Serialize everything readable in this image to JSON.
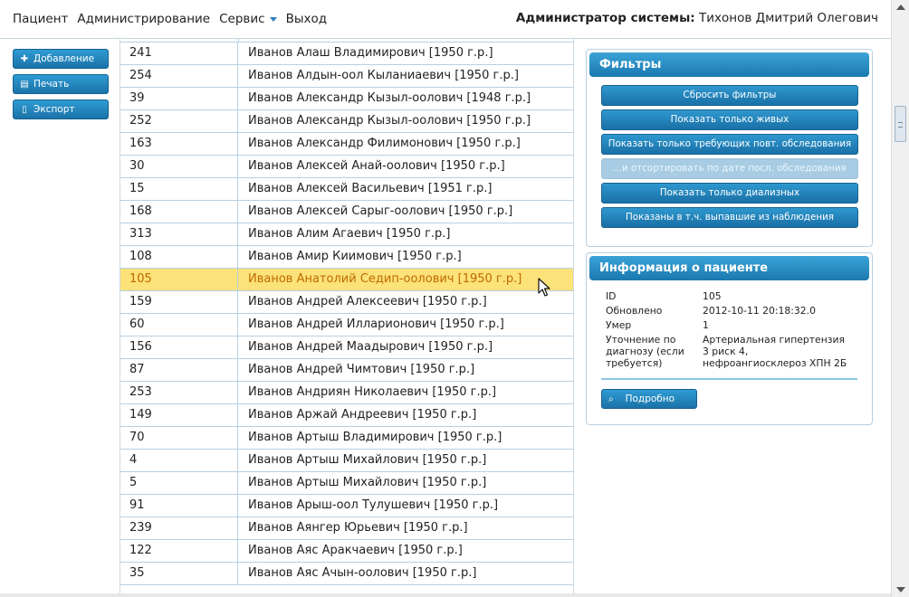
{
  "menu": {
    "items": [
      "Пациент",
      "Администрирование",
      "Сервис",
      "Выход"
    ]
  },
  "user": {
    "role": "Администратор системы",
    "name": "Тихонов Дмитрий Олегович"
  },
  "toolbar": {
    "add": "Добавление",
    "print": "Печать",
    "export": "Экспорт"
  },
  "table": {
    "rows": [
      {
        "id": "241",
        "name": "Иванов Алаш Владимирович [1950 г.р.]"
      },
      {
        "id": "254",
        "name": "Иванов Алдын-оол Кыланиаевич [1950 г.р.]"
      },
      {
        "id": "39",
        "name": "Иванов Александр Кызыл-оолович [1948 г.р.]"
      },
      {
        "id": "252",
        "name": "Иванов Александр Кызыл-оолович [1950 г.р.]"
      },
      {
        "id": "163",
        "name": "Иванов Александр Филимонович [1950 г.р.]"
      },
      {
        "id": "30",
        "name": "Иванов Алексей Анай-оолович [1950 г.р.]"
      },
      {
        "id": "15",
        "name": "Иванов Алексей Васильевич [1951 г.р.]"
      },
      {
        "id": "168",
        "name": "Иванов Алексей Сарыг-оолович [1950 г.р.]"
      },
      {
        "id": "313",
        "name": "Иванов Алим Агаевич [1950 г.р.]"
      },
      {
        "id": "108",
        "name": "Иванов Амир Киимович [1950 г.р.]"
      },
      {
        "id": "105",
        "name": "Иванов Анатолий Седип-оолович [1950 г.р.]",
        "selected": true
      },
      {
        "id": "159",
        "name": "Иванов Андрей Алексеевич [1950 г.р.]"
      },
      {
        "id": "60",
        "name": "Иванов Андрей Илларионович [1950 г.р.]"
      },
      {
        "id": "156",
        "name": "Иванов Андрей Маадырович [1950 г.р.]"
      },
      {
        "id": "87",
        "name": "Иванов Андрей Чимтович [1950 г.р.]"
      },
      {
        "id": "253",
        "name": "Иванов Андриян Николаевич [1950 г.р.]"
      },
      {
        "id": "149",
        "name": "Иванов Аржай Андреевич [1950 г.р.]"
      },
      {
        "id": "70",
        "name": "Иванов Артыш Владимирович [1950 г.р.]"
      },
      {
        "id": "4",
        "name": "Иванов Артыш Михайлович [1950 г.р.]"
      },
      {
        "id": "5",
        "name": "Иванов Артыш Михайлович [1950 г.р.]"
      },
      {
        "id": "91",
        "name": "Иванов Арыш-оол Тулушевич [1950 г.р.]"
      },
      {
        "id": "239",
        "name": "Иванов Аянгер Юрьевич [1950 г.р.]"
      },
      {
        "id": "122",
        "name": "Иванов Аяс Аракчаевич [1950 г.р.]"
      },
      {
        "id": "35",
        "name": "Иванов Аяс Ачын-оолович [1950 г.р.]"
      }
    ]
  },
  "filters": {
    "title": "Фильтры",
    "buttons": [
      {
        "label": "Сбросить фильтры",
        "enabled": true
      },
      {
        "label": "Показать только живых",
        "enabled": true
      },
      {
        "label": "Показать только требующих повт. обследования",
        "enabled": true
      },
      {
        "label": "...и отсортировать по дате посл. обследования",
        "enabled": false
      },
      {
        "label": "Показать только диализных",
        "enabled": true
      },
      {
        "label": "Показаны в т.ч. выпавшие из наблюдения",
        "enabled": true
      }
    ]
  },
  "patient_info": {
    "title": "Информация о пациенте",
    "fields": [
      {
        "key": "ID",
        "value": "105"
      },
      {
        "key": "Обновлено",
        "value": "2012-10-11 20:18:32.0"
      },
      {
        "key": "Умер",
        "value": "1"
      },
      {
        "key": "Уточнение по диагнозу (если требуется)",
        "value": "Артериальная гипертензия 3 риск 4, нефроангиосклероз ХПН 2Б"
      }
    ],
    "detail_button": "Подробно"
  },
  "colors": {
    "accent": "#1f86c0",
    "selected_row": "#fbe279",
    "selected_text": "#c06a00"
  }
}
